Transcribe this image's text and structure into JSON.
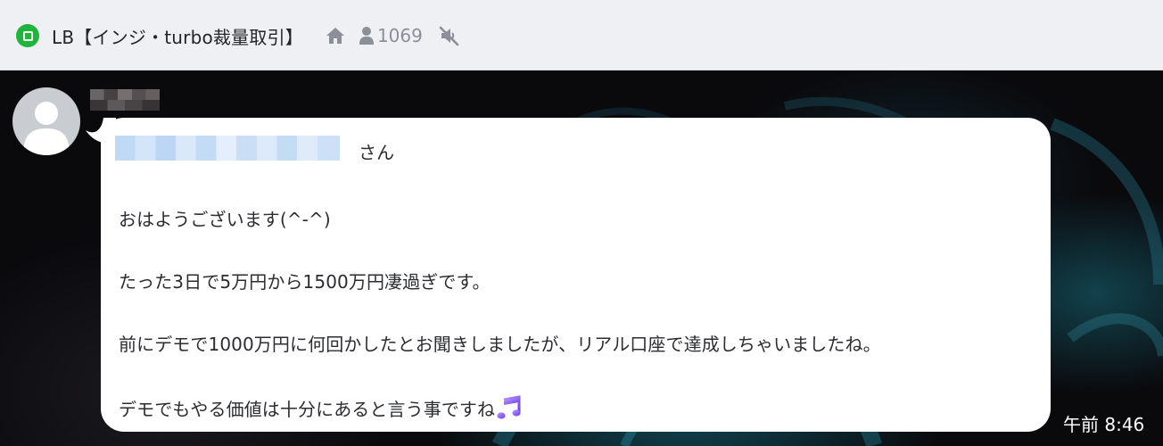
{
  "header": {
    "chat_type_icon": "openchat-square-icon",
    "title": "LB【インジ・turbo裁量取引】",
    "home_icon": "home-icon",
    "member_icon": "person-icon",
    "member_count": "1069",
    "mute_icon": "speaker-muted-icon"
  },
  "message": {
    "sender_avatar": "default-avatar-icon",
    "mention_suffix": "さん",
    "lines": [
      "おはようございます(^-^)",
      "たった3日で5万円から1500万円凄過ぎです。",
      "前にデモで1000万円に何回かしたとお聞きしましたが、リアル口座で達成しちゃいましたね。",
      "デモでもやる価値は十分にあると言う事ですね"
    ],
    "trailing_emoji": "music-notes-icon",
    "timestamp": "午前 8:46"
  },
  "colors": {
    "header_bg": "#eef0f3",
    "openchat_green": "#1eb53a",
    "bubble_bg": "#ffffff",
    "text": "#2b2d31",
    "muted_icon": "#8a8f98",
    "emoji_purple": "#8a5cf6"
  }
}
